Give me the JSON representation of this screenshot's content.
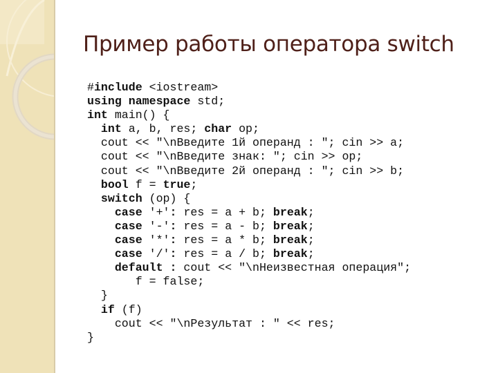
{
  "slide": {
    "title": "Пример работы оператора switch",
    "colors": {
      "title": "#4f2019",
      "sidebar": "#efe2b8",
      "code": "#111111"
    }
  },
  "code_lines": [
    [
      {
        "t": "#",
        "b": false
      },
      {
        "t": "include",
        "b": true
      },
      {
        "t": " <iostream>",
        "b": false
      }
    ],
    [
      {
        "t": "using namespace",
        "b": true
      },
      {
        "t": " std;",
        "b": false
      }
    ],
    [
      {
        "t": "int",
        "b": true
      },
      {
        "t": " main() {",
        "b": false
      }
    ],
    [
      {
        "t": "  ",
        "b": false
      },
      {
        "t": "int",
        "b": true
      },
      {
        "t": " a, b, res; ",
        "b": false
      },
      {
        "t": "char",
        "b": true
      },
      {
        "t": " op;",
        "b": false
      }
    ],
    [
      {
        "t": "  cout << \"\\nВведите 1й операнд : \"; cin >> a;",
        "b": false
      }
    ],
    [
      {
        "t": "  cout << \"\\nВведите знак: \"; cin >> op;",
        "b": false
      }
    ],
    [
      {
        "t": "  cout << \"\\nВведите 2й операнд : \"; cin >> b;",
        "b": false
      }
    ],
    [
      {
        "t": "  ",
        "b": false
      },
      {
        "t": "bool",
        "b": true
      },
      {
        "t": " f = ",
        "b": false
      },
      {
        "t": "true",
        "b": true
      },
      {
        "t": ";",
        "b": false
      }
    ],
    [
      {
        "t": "  ",
        "b": false
      },
      {
        "t": "switch",
        "b": true
      },
      {
        "t": " (op) {",
        "b": false
      }
    ],
    [
      {
        "t": "    ",
        "b": false
      },
      {
        "t": "case",
        "b": true
      },
      {
        "t": " '+'",
        "b": false
      },
      {
        "t": ":",
        "b": true
      },
      {
        "t": " res = a + b; ",
        "b": false
      },
      {
        "t": "break",
        "b": true
      },
      {
        "t": ";",
        "b": false
      }
    ],
    [
      {
        "t": "    ",
        "b": false
      },
      {
        "t": "case",
        "b": true
      },
      {
        "t": " '-'",
        "b": false
      },
      {
        "t": ":",
        "b": true
      },
      {
        "t": " res = a - b; ",
        "b": false
      },
      {
        "t": "break",
        "b": true
      },
      {
        "t": ";",
        "b": false
      }
    ],
    [
      {
        "t": "    ",
        "b": false
      },
      {
        "t": "case",
        "b": true
      },
      {
        "t": " '*'",
        "b": false
      },
      {
        "t": ":",
        "b": true
      },
      {
        "t": " res = a * b; ",
        "b": false
      },
      {
        "t": "break",
        "b": true
      },
      {
        "t": ";",
        "b": false
      }
    ],
    [
      {
        "t": "    ",
        "b": false
      },
      {
        "t": "case",
        "b": true
      },
      {
        "t": " '/'",
        "b": false
      },
      {
        "t": ":",
        "b": true
      },
      {
        "t": " res = a / b; ",
        "b": false
      },
      {
        "t": "break",
        "b": true
      },
      {
        "t": ";",
        "b": false
      }
    ],
    [
      {
        "t": "    ",
        "b": false
      },
      {
        "t": "default :",
        "b": true
      },
      {
        "t": " cout << \"\\nНеизвестная операция\";",
        "b": false
      }
    ],
    [
      {
        "t": "       f = false;",
        "b": false
      }
    ],
    [
      {
        "t": "  }",
        "b": false
      }
    ],
    [
      {
        "t": "  ",
        "b": false
      },
      {
        "t": "if",
        "b": true
      },
      {
        "t": " (f)",
        "b": false
      }
    ],
    [
      {
        "t": "    cout << \"\\nРезультат : \" << res;",
        "b": false
      }
    ],
    [
      {
        "t": "}",
        "b": false
      }
    ]
  ]
}
